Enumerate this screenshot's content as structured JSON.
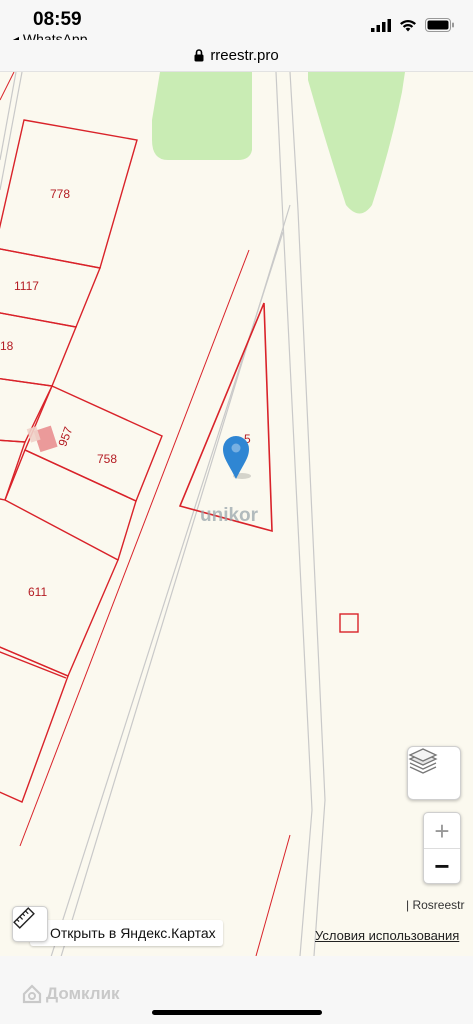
{
  "status": {
    "time": "08:59",
    "back_label": "◂ WhatsApp"
  },
  "browser": {
    "url": "rreestr.pro"
  },
  "map": {
    "parcel_labels": [
      "778",
      "1117",
      "18",
      "957",
      "758",
      "611",
      "5"
    ],
    "watermark_logo": "unikor",
    "attribution": "| Rosreestr",
    "terms_link": "Условия использования",
    "open_in_yandex": "Открыть в Яндекс.Картах",
    "zoom_in": "+",
    "zoom_out": "−",
    "colors": {
      "parcel_border": "#d9232a",
      "background": "#fbf9ef",
      "green_area": "#c9ecb4",
      "marker": "#2f86d3"
    }
  },
  "footer": {
    "watermark": "Домклик"
  }
}
